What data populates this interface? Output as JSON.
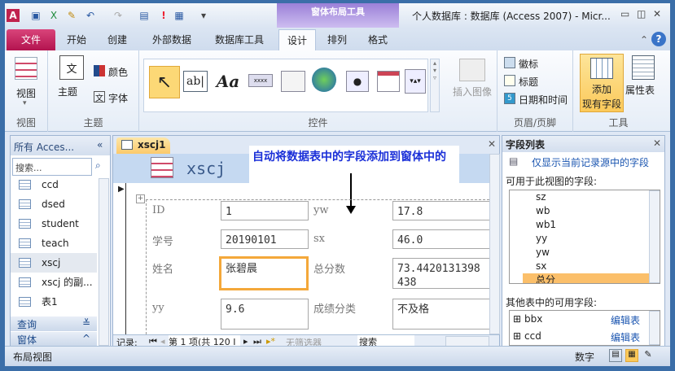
{
  "titlebar": {
    "title": "个人数据库 : 数据库 (Access 2007) - Micr...",
    "context_tab": "窗体布局工具"
  },
  "tabs": [
    "文件",
    "开始",
    "创建",
    "外部数据",
    "数据库工具",
    "设计",
    "排列",
    "格式"
  ],
  "ribbon": {
    "view": {
      "button": "视图",
      "group": "视图"
    },
    "theme": {
      "theme": "主题",
      "colors": "颜色",
      "fonts": "字体",
      "group": "主题"
    },
    "controls": {
      "group": "控件",
      "insert_image": "插入图像"
    },
    "header_footer": {
      "logo": "徽标",
      "title": "标题",
      "datetime": "日期和时间",
      "group": "页眉/页脚"
    },
    "tools": {
      "add_fields_1": "添加",
      "add_fields_2": "现有字段",
      "property_sheet": "属性表",
      "group": "工具"
    }
  },
  "nav": {
    "header": "所有 Acces...",
    "search_placeholder": "搜索...",
    "items": [
      "ccd",
      "dsed",
      "student",
      "teach",
      "xscj",
      "xscj 的副...",
      "表1"
    ],
    "groups": [
      "查询",
      "窗体"
    ]
  },
  "document": {
    "tab": "xscj1",
    "form_title": "xscj",
    "callout": "自动将数据表中的字段添加到窗体中的",
    "fields": [
      {
        "label": "ID",
        "value": "1"
      },
      {
        "label": "yw",
        "value": "17.8"
      },
      {
        "label": "学号",
        "value": "20190101"
      },
      {
        "label": "sx",
        "value": "46.0"
      },
      {
        "label": "姓名",
        "value": "张碧晨"
      },
      {
        "label": "总分数",
        "value": "73.4420131398438"
      },
      {
        "label": "yy",
        "value": "9.6"
      },
      {
        "label": "成绩分类",
        "value": "不及格"
      }
    ],
    "record_nav": {
      "label": "记录:",
      "position": "第 1 项(共 120 I",
      "filter": "无筛选器",
      "search": "搜索"
    }
  },
  "field_list": {
    "title": "字段列表",
    "show_only": "仅显示当前记录源中的字段",
    "available_label": "可用于此视图的字段:",
    "available": [
      "sz",
      "wb",
      "wb1",
      "yy",
      "yw",
      "sx",
      "总分"
    ],
    "selected": "总分",
    "other_label": "其他表中的可用字段:",
    "other": [
      {
        "name": "bbx",
        "action": "编辑表"
      },
      {
        "name": "ccd",
        "action": "编辑表"
      }
    ]
  },
  "status": {
    "left": "布局视图",
    "mode": "数字"
  },
  "colors": {
    "accent": "#fbbf5a",
    "file_tab": "#c41e5a",
    "window": "#3b6ea8"
  }
}
